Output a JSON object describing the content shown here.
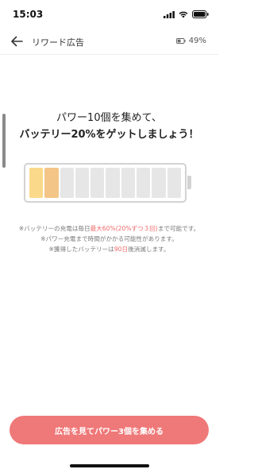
{
  "status_bar": {
    "time": "15:03",
    "icons": [
      "signal-icon",
      "wifi-icon",
      "battery-icon"
    ]
  },
  "header": {
    "title": "リワード広告",
    "battery_percent": "49%",
    "back_icon": "arrow-left-icon"
  },
  "headline": {
    "line1": "パワー10個を集めて、",
    "line2": "バッテリー20%をゲットしましょう！"
  },
  "power_meter": {
    "total_cells": 10,
    "filled_cells": 2,
    "cell_colors": [
      "#fbd98a",
      "#f3c587"
    ],
    "empty_color": "#e6e6e6"
  },
  "notes": {
    "line1_pre": "※バッテリーの充電は毎日",
    "line1_highlight": "最大60%(20%ずつ３回)",
    "line1_post": "まで可能です。",
    "line2": "※パワー充電まで時間がかかる可能性があります。",
    "line3_pre": "※獲得したバッテリーは",
    "line3_highlight": "90日",
    "line3_post": "後消滅します。"
  },
  "cta": {
    "label": "広告を見てパワー3個を集める"
  },
  "colors": {
    "accent": "#ef7878",
    "highlight_text": "#ef6b6b"
  }
}
